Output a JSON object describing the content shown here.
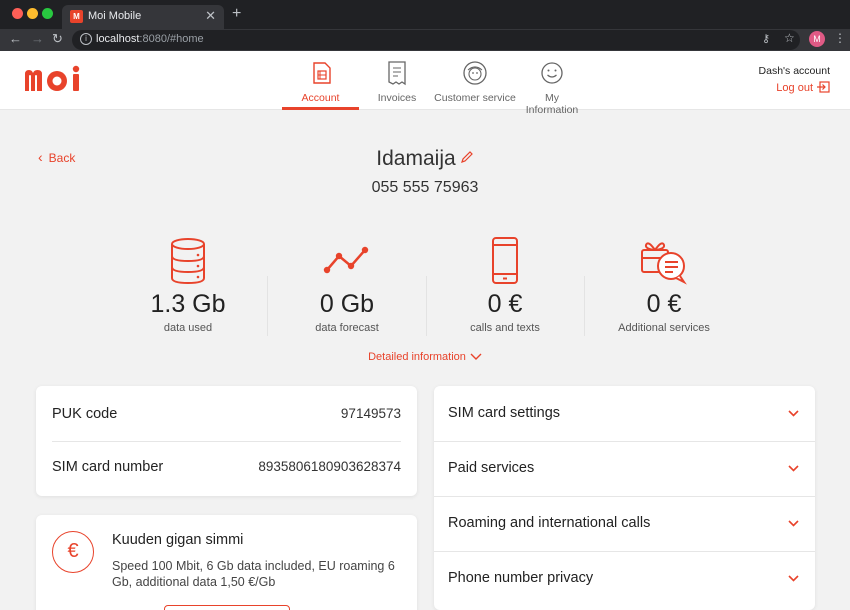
{
  "browser": {
    "tab_title": "Moi Mobile",
    "favicon": "M",
    "url_host": "localhost",
    "url_rest": ":8080/#home",
    "profile_initial": "M"
  },
  "header": {
    "logo_text": "moi",
    "nav": [
      {
        "label": "Account",
        "icon": "sim-card-icon",
        "active": true
      },
      {
        "label": "Invoices",
        "icon": "invoice-icon",
        "active": false
      },
      {
        "label": "Customer service",
        "icon": "customer-service-icon",
        "active": false
      },
      {
        "label": "My Information",
        "icon": "smiley-icon",
        "active": false
      }
    ],
    "account_name": "Dash's account",
    "logout_label": "Log out"
  },
  "subscription": {
    "back_label": "Back",
    "name": "Idamaija",
    "number": "055 555 75963"
  },
  "stats": [
    {
      "value": "1.3 Gb",
      "label": "data used",
      "icon": "database-icon"
    },
    {
      "value": "0 Gb",
      "label": "data forecast",
      "icon": "trend-line-icon"
    },
    {
      "value": "0 €",
      "label": "calls and texts",
      "icon": "phone-icon"
    },
    {
      "value": "0 €",
      "label": "Additional services",
      "icon": "gift-message-icon"
    }
  ],
  "detailed_label": "Detailed information",
  "sim_info": {
    "puk_label": "PUK code",
    "puk_value": "97149573",
    "sim_label": "SIM card number",
    "sim_value": "8935806180903628374"
  },
  "plan": {
    "title": "Kuuden gigan simmi",
    "description": "Speed 100 Mbit, 6 Gb data included, EU roaming 6 Gb, additional data 1,50 €/Gb"
  },
  "accordion": [
    {
      "label": "SIM card settings"
    },
    {
      "label": "Paid services"
    },
    {
      "label": "Roaming and international calls"
    },
    {
      "label": "Phone number privacy"
    }
  ],
  "colors": {
    "accent": "#e8432b",
    "background": "#f2f2f2"
  }
}
